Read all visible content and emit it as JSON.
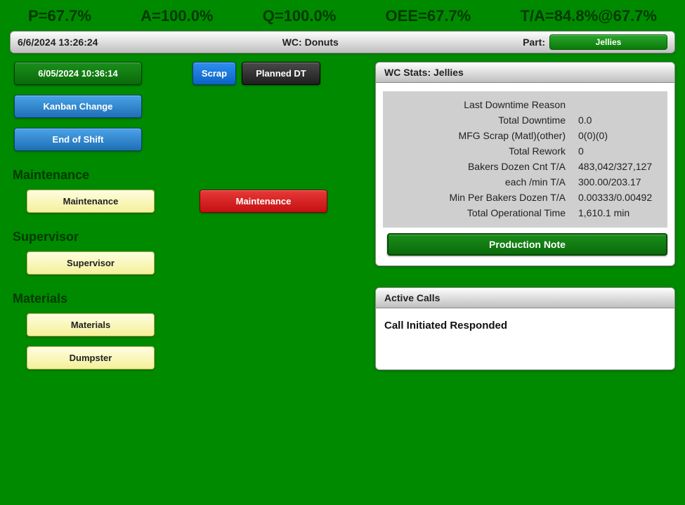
{
  "metrics": {
    "p": "P=67.7%",
    "a": "A=100.0%",
    "q": "Q=100.0%",
    "oee": "OEE=67.7%",
    "ta": "T/A=84.8%@67.7%"
  },
  "header": {
    "datetime": "6/6/2024 13:26:24",
    "wc": "WC: Donuts",
    "part_label": "Part:",
    "part_value": "Jellies"
  },
  "buttons": {
    "timestamp": "6/05/2024 10:36:14",
    "kanban": "Kanban Change",
    "endshift": "End of Shift",
    "scrap": "Scrap",
    "planned_dt": "Planned DT",
    "maintenance_y": "Maintenance",
    "maintenance_r": "Maintenance",
    "supervisor": "Supervisor",
    "materials": "Materials",
    "dumpster": "Dumpster",
    "prod_note": "Production Note"
  },
  "sections": {
    "maintenance": "Maintenance",
    "supervisor": "Supervisor",
    "materials": "Materials"
  },
  "stats_panel": {
    "title": "WC Stats: Jellies",
    "rows": [
      {
        "label": "Last Downtime Reason",
        "value": ""
      },
      {
        "label": "Total Downtime",
        "value": "0.0"
      },
      {
        "label": "MFG Scrap (Matl)(other)",
        "value": "0(0)(0)"
      },
      {
        "label": "Total Rework",
        "value": "0"
      },
      {
        "label": "Bakers Dozen Cnt T/A",
        "value": "483,042/327,127"
      },
      {
        "label": "each /min T/A",
        "value": "300.00/203.17"
      },
      {
        "label": "Min Per Bakers Dozen T/A",
        "value": "0.00333/0.00492"
      },
      {
        "label": "Total Operational Time",
        "value": "1,610.1 min"
      }
    ]
  },
  "active_calls": {
    "title": "Active Calls",
    "text": "Call Initiated Responded"
  }
}
